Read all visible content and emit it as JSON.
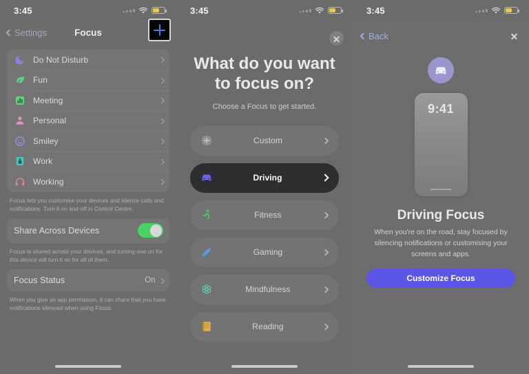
{
  "panel1": {
    "status": {
      "time": "3:45",
      "wifi_icon": "wifi-icon",
      "battery_icon": "battery-low-power-icon"
    },
    "nav": {
      "back_label": "Settings",
      "title": "Focus",
      "add_label": "+",
      "add_icon": "plus-icon"
    },
    "focus_rows": [
      {
        "label": "Do Not Disturb",
        "icon": "moon-icon",
        "color": "#8e7fe0"
      },
      {
        "label": "Fun",
        "icon": "leaf-icon",
        "color": "#5ed18a"
      },
      {
        "label": "Meeting",
        "icon": "chart-bar-icon",
        "color": "#62d17e"
      },
      {
        "label": "Personal",
        "icon": "person-icon",
        "color": "#e08fc0"
      },
      {
        "label": "Smiley",
        "icon": "smiley-icon",
        "color": "#9b8fe0"
      },
      {
        "label": "Work",
        "icon": "briefcase-icon",
        "color": "#4fc5c0"
      },
      {
        "label": "Working",
        "icon": "headphones-icon",
        "color": "#e0888f"
      }
    ],
    "footnote1": "Focus lets you customise your devices and silence calls and notifications. Turn it on and off in Control Centre.",
    "share_row": {
      "label": "Share Across Devices",
      "toggle_state": "on",
      "toggle_color": "#4cd264"
    },
    "footnote2": "Focus is shared across your devices, and turning one on for this device will turn it on for all of them.",
    "status_row": {
      "label": "Focus Status",
      "value": "On"
    },
    "footnote3": "When you give an app permission, it can share that you have notifications silenced when using Focus."
  },
  "panel2": {
    "status": {
      "time": "3:45"
    },
    "close_icon": "close-icon",
    "heading": "What do you want to focus on?",
    "subheading": "Choose a Focus to get started.",
    "options": [
      {
        "label": "Custom",
        "icon": "plus-circle-icon",
        "color": "#c9c9c9",
        "selected": false
      },
      {
        "label": "Driving",
        "icon": "car-icon",
        "color": "#6a63e8",
        "selected": true
      },
      {
        "label": "Fitness",
        "icon": "running-icon",
        "color": "#4bc96a",
        "selected": false
      },
      {
        "label": "Gaming",
        "icon": "joystick-icon",
        "color": "#4f9ee8",
        "selected": false
      },
      {
        "label": "Mindfulness",
        "icon": "flower-icon",
        "color": "#62c8b0",
        "selected": false
      },
      {
        "label": "Reading",
        "icon": "book-icon",
        "color": "#e0b14f",
        "selected": false
      }
    ]
  },
  "panel3": {
    "status": {
      "time": "3:45"
    },
    "nav": {
      "back_label": "Back",
      "close_icon": "close-icon"
    },
    "hero_icon": "car-icon",
    "hero_icon_bg": "#9b97ce",
    "phone_time": "9:41",
    "title": "Driving Focus",
    "description": "When you're on the road, stay focused by silencing notifications or customising your screens and apps.",
    "cta_label": "Customize Focus",
    "cta_color": "#5b55e8"
  }
}
